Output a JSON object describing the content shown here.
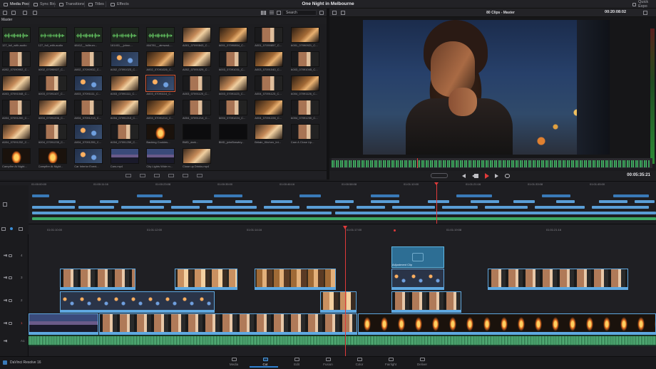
{
  "top_nav": {
    "media_pool": "Media Pool",
    "sync_bin": "Sync Bin",
    "transitions": "Transitions",
    "titles": "Titles",
    "effects": "Effects",
    "project_title": "One Night in Melbourne",
    "quick_export": "Quick Expo"
  },
  "media_pool": {
    "search_placeholder": "Search",
    "bin_name": "Master",
    "clips": [
      {
        "name": "127_full_with-audio",
        "kind": "aud"
      },
      {
        "name": "127_full_with-audio",
        "kind": "aud"
      },
      {
        "name": "48412__fulltrum...",
        "kind": "aud"
      },
      {
        "name": "161401__johnn...",
        "kind": "aud"
      },
      {
        "name": "464781__aimwad-...",
        "kind": "aud"
      },
      {
        "name": "A001_07090843_C...",
        "kind": "warm"
      },
      {
        "name": "A001_07090854_C...",
        "kind": "gold"
      },
      {
        "name": "A001_07090857_C...",
        "kind": "face"
      },
      {
        "name": "A001_07090921_C...",
        "kind": "gold"
      },
      {
        "name": "A002_07090902_C...",
        "kind": "face"
      },
      {
        "name": "A002_07090927_C...",
        "kind": "warm"
      },
      {
        "name": "A002_07090932_C...",
        "kind": "face"
      },
      {
        "name": "A002_07091023_C...",
        "kind": "bokeh"
      },
      {
        "name": "A002_07091026_C...",
        "kind": "gold"
      },
      {
        "name": "A002_07091029_C...",
        "kind": "warm"
      },
      {
        "name": "A003_07091031_C...",
        "kind": "face"
      },
      {
        "name": "A003_07091040_C...",
        "kind": "gold"
      },
      {
        "name": "A003_07091045_C...",
        "kind": "face"
      },
      {
        "name": "A003_07091048_C...",
        "kind": "warm"
      },
      {
        "name": "A003_07091107_C...",
        "kind": "face"
      },
      {
        "name": "A003_07091111_C...",
        "kind": "bokeh"
      },
      {
        "name": "A003_07091111_C...",
        "kind": "warm"
      },
      {
        "name": "A003_07091114_C...",
        "kind": "bokeh",
        "selected": true
      },
      {
        "name": "A003_07091120_C...",
        "kind": "face"
      },
      {
        "name": "A003_07091123_C...",
        "kind": "warm"
      },
      {
        "name": "A004_07091123_C...",
        "kind": "face"
      },
      {
        "name": "A004_07091126_C...",
        "kind": "gold"
      },
      {
        "name": "A004_07091200_C...",
        "kind": "face"
      },
      {
        "name": "A004_07091206_C...",
        "kind": "warm"
      },
      {
        "name": "A004_07091213_C...",
        "kind": "face"
      },
      {
        "name": "A004_07091213_C...",
        "kind": "warm"
      },
      {
        "name": "A004_07091214_C...",
        "kind": "gold"
      },
      {
        "name": "A004_07091214_C...",
        "kind": "face"
      },
      {
        "name": "A004_07091224_C...",
        "kind": "face"
      },
      {
        "name": "A004_07091228_C...",
        "kind": "gold"
      },
      {
        "name": "A004_07091230_C...",
        "kind": "face"
      },
      {
        "name": "A004_07091232_C...",
        "kind": "warm"
      },
      {
        "name": "A004_07091235_C...",
        "kind": "face"
      },
      {
        "name": "A004_07091255_C...",
        "kind": "bokeh"
      },
      {
        "name": "A004_07091259_C...",
        "kind": "face"
      },
      {
        "name": "Backing Cookies...",
        "kind": "fire"
      },
      {
        "name": "BMD_dark...",
        "kind": "dark"
      },
      {
        "name": "BMD_johnBrawley...",
        "kind": "dark"
      },
      {
        "name": "Britain_Kitchen_Int...",
        "kind": "warm"
      },
      {
        "name": "Cam A Close Up...",
        "kind": "face"
      },
      {
        "name": "Campfire At Night...",
        "kind": "fire"
      },
      {
        "name": "Campfire At Night...",
        "kind": "fire"
      },
      {
        "name": "Car Interior Eveni...",
        "kind": "bokeh"
      },
      {
        "name": "Cars.mp4",
        "kind": "city"
      },
      {
        "name": "City Lights Wide m...",
        "kind": "city"
      },
      {
        "name": "Close up Drinks.mp4",
        "kind": "warm"
      }
    ]
  },
  "viewer": {
    "clip_count": "80 Clips - Master",
    "timecode": "00:20:08:02",
    "playback_timecode": "00:05:35:21"
  },
  "upper_ruler": [
    "01:00:00:00",
    "01:00:11:16",
    "01:00:23:08",
    "01:00:35:00",
    "01:00:46:16",
    "01:00:58:08",
    "01:01:10:00",
    "01:01:21:16",
    "01:01:33:08",
    "01:01:45:00"
  ],
  "lower_ruler": [
    "01:01:10:00",
    "01:01:12:00",
    "01:01:14:16",
    "01:01:17:00",
    "01:01:19:08",
    "01:01:21:16"
  ],
  "tracks": {
    "v4": "4",
    "v3": "3",
    "v2": "2",
    "v1": "1",
    "a1": "A1"
  },
  "adjustment_clip_label": "Adjustment Clip",
  "app_name": "DaVinci Resolve 16",
  "pages": [
    "Media",
    "Cut",
    "Edit",
    "Fusion",
    "Color",
    "Fairlight",
    "Deliver"
  ],
  "active_page": "Cut",
  "colors": {
    "accent_blue": "#2f7fd0",
    "playhead_red": "#e03a3a",
    "audio_green": "#5fcf8a",
    "clip_blue": "#5fa8e0"
  }
}
